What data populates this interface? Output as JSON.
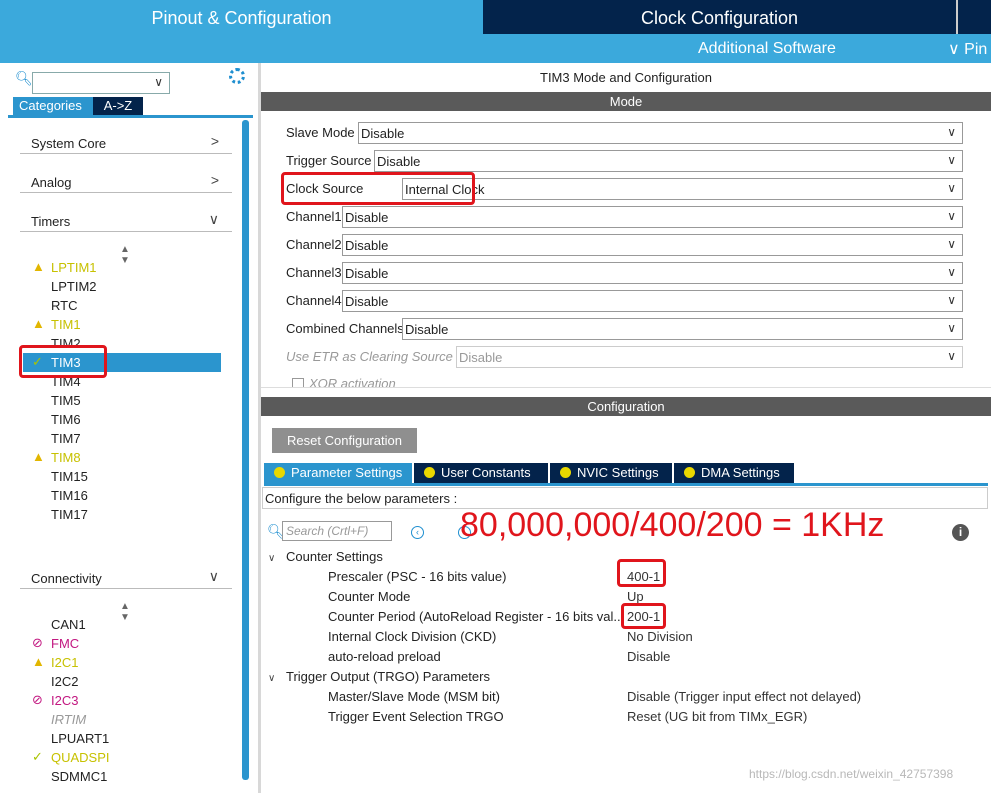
{
  "top_tabs": {
    "pinout": "Pinout & Configuration",
    "clock": "Clock Configuration",
    "pin_partial": "Pin"
  },
  "sub_bar": {
    "additional_software": "Additional Software",
    "chevron": "∨"
  },
  "left_panel": {
    "tabs": {
      "categories": "Categories",
      "az": "A->Z"
    },
    "categories": [
      {
        "label": "System Core",
        "chevron": ">"
      },
      {
        "label": "Analog",
        "chevron": ">"
      },
      {
        "label": "Timers",
        "chevron": "∨"
      },
      {
        "label": "Connectivity",
        "chevron": "∨"
      }
    ],
    "timers": [
      {
        "label": "LPTIM1",
        "status": "warn"
      },
      {
        "label": "LPTIM2",
        "status": "none"
      },
      {
        "label": "RTC",
        "status": "none"
      },
      {
        "label": "TIM1",
        "status": "warn"
      },
      {
        "label": "TIM2",
        "status": "none"
      },
      {
        "label": "TIM3",
        "status": "ok",
        "selected": true
      },
      {
        "label": "TIM4",
        "status": "none"
      },
      {
        "label": "TIM5",
        "status": "none"
      },
      {
        "label": "TIM6",
        "status": "none"
      },
      {
        "label": "TIM7",
        "status": "none"
      },
      {
        "label": "TIM8",
        "status": "warn"
      },
      {
        "label": "TIM15",
        "status": "none"
      },
      {
        "label": "TIM16",
        "status": "none"
      },
      {
        "label": "TIM17",
        "status": "none"
      }
    ],
    "connectivity": [
      {
        "label": "CAN1",
        "status": "none"
      },
      {
        "label": "FMC",
        "status": "disabled"
      },
      {
        "label": "I2C1",
        "status": "warn"
      },
      {
        "label": "I2C2",
        "status": "none"
      },
      {
        "label": "I2C3",
        "status": "disabled"
      },
      {
        "label": "IRTIM",
        "status": "unavailable"
      },
      {
        "label": "LPUART1",
        "status": "none"
      },
      {
        "label": "QUADSPI",
        "status": "ok"
      },
      {
        "label": "SDMMC1",
        "status": "none"
      }
    ],
    "icons": {
      "warn": "▲",
      "ok": "✓",
      "disabled": "⊘"
    }
  },
  "mode_panel": {
    "title": "TIM3 Mode and Configuration",
    "mode_header": "Mode",
    "fields": [
      {
        "label": "Slave Mode",
        "value": "Disable"
      },
      {
        "label": "Trigger Source",
        "value": "Disable"
      },
      {
        "label": "Clock Source",
        "value": "Internal Clock"
      },
      {
        "label": "Channel1",
        "value": "Disable"
      },
      {
        "label": "Channel2",
        "value": "Disable"
      },
      {
        "label": "Channel3",
        "value": "Disable"
      },
      {
        "label": "Channel4",
        "value": "Disable"
      },
      {
        "label": "Combined Channels",
        "value": "Disable"
      },
      {
        "label": "Use ETR as Clearing Source",
        "value": "Disable"
      }
    ],
    "xor_label": "XOR activation",
    "dropdown_chevron": "∨"
  },
  "config_panel": {
    "header": "Configuration",
    "reset_button": "Reset Configuration",
    "tabs": [
      "Parameter Settings",
      "User Constants",
      "NVIC Settings",
      "DMA Settings"
    ],
    "hint": "Configure the below parameters :",
    "search_placeholder": "Search (Crtl+F)",
    "annotation": "80,000,000/400/200 = 1KHz",
    "info_icon": "i",
    "groups": [
      {
        "title": "Counter Settings",
        "params": [
          {
            "name": "Prescaler (PSC - 16 bits value)",
            "value": "400-1"
          },
          {
            "name": "Counter Mode",
            "value": "Up"
          },
          {
            "name": "Counter Period (AutoReload Register - 16 bits val...",
            "value": "200-1"
          },
          {
            "name": "Internal Clock Division (CKD)",
            "value": "No Division"
          },
          {
            "name": "auto-reload preload",
            "value": "Disable"
          }
        ]
      },
      {
        "title": "Trigger Output (TRGO) Parameters",
        "params": [
          {
            "name": "Master/Slave Mode (MSM bit)",
            "value": "Disable (Trigger input effect not delayed)"
          },
          {
            "name": "Trigger Event Selection TRGO",
            "value": "Reset (UG bit from TIMx_EGR)"
          }
        ]
      }
    ]
  },
  "watermark": "https://blog.csdn.net/weixin_42757398",
  "colors": {
    "accent": "#2b95ce",
    "dark_tab": "#03234b",
    "highlight_red": "#e0151c",
    "warn_yellow": "#e2b600"
  }
}
